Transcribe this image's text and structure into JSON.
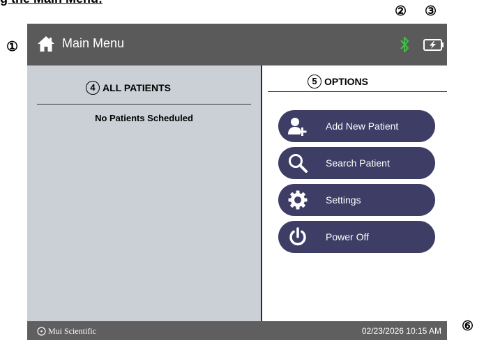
{
  "page_heading": "g the Main Menu:",
  "callouts": {
    "c1": "①",
    "c2": "②",
    "c3": "③",
    "c4": "④",
    "c5": "⑤",
    "c6": "⑥"
  },
  "topbar": {
    "title": "Main Menu",
    "icons": {
      "home": "home-icon",
      "bluetooth": "bluetooth-icon",
      "battery": "battery-charging-icon"
    },
    "bluetooth_color": "#3fbf3f"
  },
  "left_panel": {
    "number": "4",
    "title": "ALL PATIENTS",
    "empty_message": "No Patients Scheduled",
    "background": "#cbd0d6"
  },
  "right_panel": {
    "number": "5",
    "title": "OPTIONS",
    "buttons": [
      {
        "label": "Add New Patient",
        "icon": "add-user-icon"
      },
      {
        "label": "Search Patient",
        "icon": "search-icon"
      },
      {
        "label": "Settings",
        "icon": "gear-icon"
      },
      {
        "label": "Power Off",
        "icon": "power-icon"
      }
    ],
    "button_color": "#3d3d66"
  },
  "footer": {
    "brand": "Mui Scientific",
    "datetime": "02/23/2026 10:15 AM"
  }
}
